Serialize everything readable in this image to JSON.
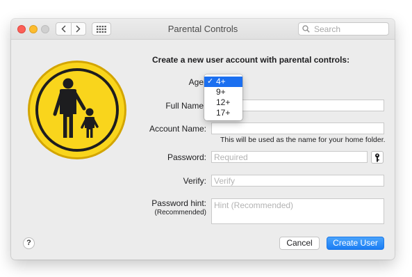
{
  "window": {
    "title": "Parental Controls",
    "search_placeholder": "Search"
  },
  "form": {
    "heading": "Create a new user account with parental controls:",
    "age_label": "Age",
    "age_options": [
      "4+",
      "9+",
      "12+",
      "17+"
    ],
    "age_selected": "4+",
    "full_name_label": "Full Name",
    "full_name_value": "",
    "account_name_label": "Account Name:",
    "account_name_value": "",
    "account_name_note": "This will be used as the name for your home folder.",
    "password_label": "Password:",
    "password_placeholder": "Required",
    "verify_label": "Verify:",
    "verify_placeholder": "Verify",
    "hint_label": "Password hint:",
    "hint_sublabel": "(Recommended)",
    "hint_placeholder": "Hint (Recommended)"
  },
  "buttons": {
    "help": "?",
    "cancel": "Cancel",
    "create": "Create User"
  },
  "colors": {
    "accent": "#1b6ff0",
    "badge_yellow": "#f9d51c",
    "badge_border": "#d3a500"
  }
}
